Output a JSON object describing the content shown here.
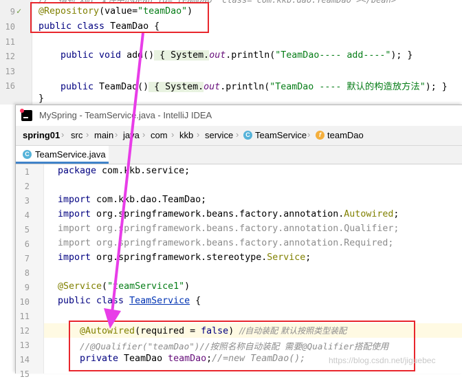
{
  "back_editor": {
    "lines": [
      {
        "num": "9",
        "code_ann": "@Repository",
        "code_rest": "(value=",
        "code_str": "\"teamDao\"",
        "code_end": ")"
      },
      {
        "num": "10",
        "kw": "public class ",
        "rest": "TeamDao {"
      },
      {
        "num": "11"
      },
      {
        "num": "12",
        "kw": "public void ",
        "name": "add",
        "paren": "()",
        "body1": " { System.",
        "fld": "out",
        "body2": ".println(",
        "str": "\"TeamDao---- add----\"",
        "end": "); }"
      },
      {
        "num": "13"
      },
      {
        "num": "16",
        "kw": "public ",
        "name": "TeamDao",
        "paren": "()",
        "body1": " { System.",
        "fld": "out",
        "body2": ".println(",
        "str": "\"TeamDao ---- 默认的构造放方法\"",
        "end": "); }"
      },
      {
        "num": "",
        "rest": "}"
      }
    ],
    "top_comment": "//  指到 xml 文件中的bean id=\"teamDao\" class=\"com.kkb.dao.TeamDao\"></bean>"
  },
  "window": {
    "title": "MySpring - TeamService.java - IntelliJ IDEA",
    "breadcrumbs": [
      "spring01",
      "src",
      "main",
      "java",
      "com",
      "kkb",
      "service",
      "TeamService",
      "teamDao"
    ],
    "tab_label": "TeamService.java",
    "class_icon_letter": "C",
    "field_icon_letter": "f"
  },
  "front_editor": {
    "line_numbers": [
      "1",
      "2",
      "3",
      "4",
      "5",
      "6",
      "7",
      "8",
      "9",
      "10",
      "11",
      "12",
      "13",
      "14",
      "15"
    ],
    "l1_kw": "package ",
    "l1_rest": "com.kkb.service;",
    "l3_kw": "import ",
    "l3_rest": "com.kkb.dao.TeamDao;",
    "l4_kw": "import ",
    "l4_rest": "org.springframework.beans.factory.annotation.",
    "l4_ann": "Autowired",
    "l4_end": ";",
    "l5_kw": "import ",
    "l5_rest": "org.springframework.beans.factory.annotation.Qualifier;",
    "l6_kw": "import ",
    "l6_rest": "org.springframework.beans.factory.annotation.Required;",
    "l7_kw": "import ",
    "l7_rest": "org.springframework.stereotype.",
    "l7_ann": "Service",
    "l7_end": ";",
    "l9_ann": "@Service",
    "l9_open": "(",
    "l9_str": "\"teamService1\"",
    "l9_close": ")",
    "l10_kw": "public class ",
    "l10_cls": "TeamService",
    "l10_end": " {",
    "l12_ann": "@Autowired",
    "l12_open": "(",
    "l12_param": "required",
    "l12_eq": " = ",
    "l12_kw": "false",
    "l12_close": ") ",
    "l12_cmt": "//自动装配 默认按照类型装配",
    "l13_cmt": "//@Qualifier(\"teamDao\")//按照名称自动装配 需要@Qualifier搭配使用",
    "l14_kw": "private ",
    "l14_type": "TeamDao ",
    "l14_var": "teamDao",
    "l14_semi": ";",
    "l14_cmt": "//=new TeamDao();"
  },
  "watermark": "https://blog.csdn.net/jiguebec",
  "colors": {
    "keyword": "#000080",
    "annotation": "#808000",
    "string": "#067d17",
    "comment": "#8c8c8c",
    "highlight_box": "#e8262c",
    "arrow": "#e83de8"
  }
}
